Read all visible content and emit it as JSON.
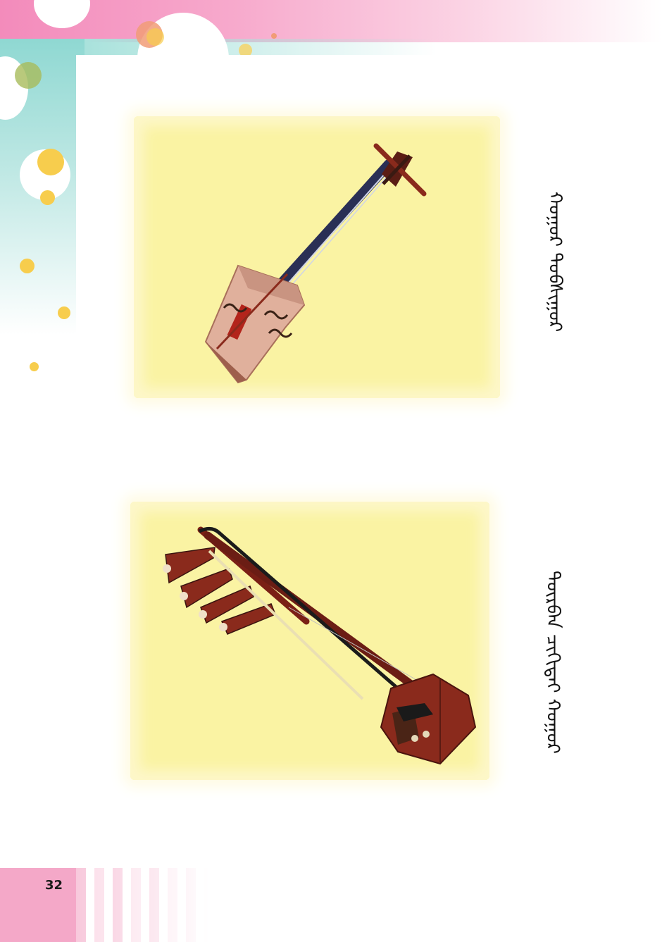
{
  "page": {
    "number": "32"
  },
  "instruments": [
    {
      "caption": "ᠬᠤᠭᠤᠷ ᠲᠣᠪᠰᠢᠭᠤᠷ",
      "icon": "shanaz-lute-icon"
    },
    {
      "caption": "ᠳᠥᠷᠪᠡᠨ ᠴᠢᠬᠢᠲᠡᠢ ᠬᠤᠭᠤᠷ",
      "icon": "four-string-fiddle-icon"
    }
  ],
  "colors": {
    "accent_pink": "#f38bbb",
    "accent_teal": "#8fd8d2",
    "photo_background": "#faf3a3",
    "dot_yellow": "#f7cd4d",
    "wood_red": "#8a2a1c"
  }
}
